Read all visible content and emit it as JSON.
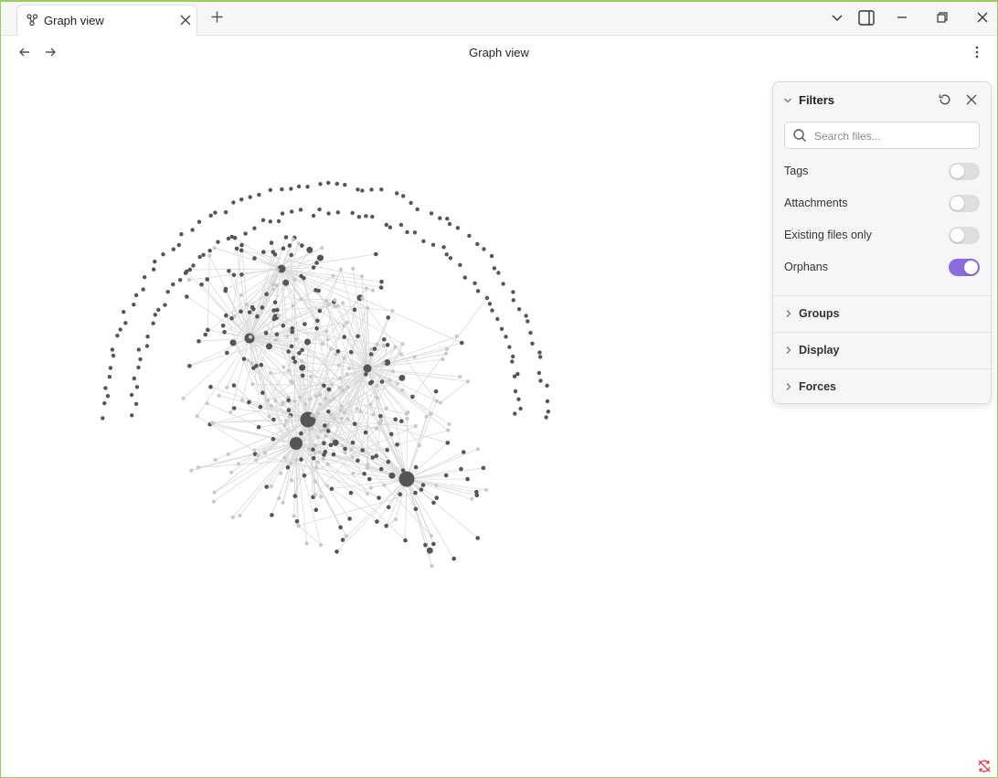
{
  "tab": {
    "title": "Graph view",
    "icon": "graph-icon"
  },
  "header": {
    "title": "Graph view"
  },
  "filters": {
    "title": "Filters",
    "search_placeholder": "Search files...",
    "options": [
      {
        "label": "Tags",
        "enabled": false
      },
      {
        "label": "Attachments",
        "enabled": false
      },
      {
        "label": "Existing files only",
        "enabled": false
      },
      {
        "label": "Orphans",
        "enabled": true
      }
    ],
    "sections": [
      "Groups",
      "Display",
      "Forces"
    ]
  },
  "colors": {
    "accent": "#8b6cdf",
    "node_dark": "#555555",
    "node_light": "#c8c8c8",
    "edge": "#dadada",
    "sync_icon": "#e03b4a"
  },
  "icons": {
    "back": "arrow-left-icon",
    "forward": "arrow-right-icon",
    "more": "more-options-icon",
    "reset": "reset-icon",
    "close": "close-icon",
    "search": "search-icon",
    "sync_status": "sync-error-icon"
  }
}
